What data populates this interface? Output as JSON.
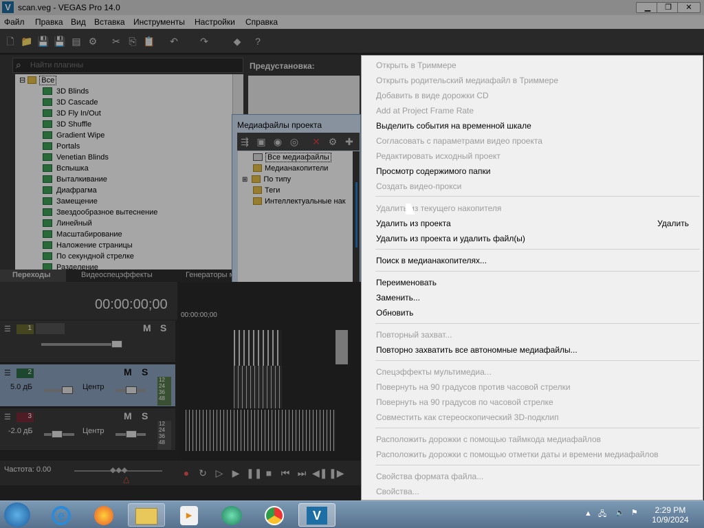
{
  "window": {
    "title": "scan.veg - VEGAS Pro 14.0",
    "minimize": "▁",
    "maximize": "❐",
    "close": "✕"
  },
  "menubar": [
    "Файл",
    "Правка",
    "Вид",
    "Вставка",
    "Инструменты",
    "Настройки",
    "Справка"
  ],
  "plugins": {
    "search_placeholder": "Найти плагины",
    "root": "Все",
    "items": [
      "3D Blinds",
      "3D Cascade",
      "3D Fly In/Out",
      "3D Shuffle",
      "Gradient Wipe",
      "Portals",
      "Venetian Blinds",
      "Вспышка",
      "Выталкивание",
      "Диафрагма",
      "Замещение",
      "Звездообразное вытеснение",
      "Линейный",
      "Масштабирование",
      "Наложение страницы",
      "По секундной стрелке",
      "Разделение"
    ],
    "tabs": [
      "Переходы",
      "Видеоспецэффекты",
      "Генераторы м"
    ]
  },
  "preset": {
    "label": "Предустановка:"
  },
  "media": {
    "title": "Медиафайлы проекта",
    "tree": [
      "Все медиафайлы",
      "Медианакопители",
      "По типу",
      "Теги",
      "Интеллектуальные нак"
    ]
  },
  "timeline": {
    "timecode": "00:00:00;00",
    "ruler_time": "00:00:00;00",
    "tracks": [
      {
        "num": "1",
        "mute": "M",
        "solo": "S"
      },
      {
        "num": "2",
        "mute": "M",
        "solo": "S",
        "volume": "5.0 дБ",
        "pan": "Центр",
        "meter": [
          "12",
          "24",
          "36",
          "48"
        ]
      },
      {
        "num": "3",
        "mute": "M",
        "solo": "S",
        "volume": "-2.0 дБ",
        "pan": "Центр",
        "meter": [
          "12",
          "24",
          "36",
          "48"
        ]
      }
    ],
    "rate": "Частота: 0.00"
  },
  "context_menu": {
    "items": [
      {
        "label": "Открыть в Триммере",
        "disabled": true
      },
      {
        "label": "Открыть родительский медиафайл в Триммере",
        "disabled": true
      },
      {
        "label": "Добавить в виде дорожки CD",
        "disabled": true
      },
      {
        "label": "Add at Project Frame Rate",
        "disabled": true
      },
      {
        "label": "Выделить события на временной шкале",
        "disabled": false
      },
      {
        "label": "Согласовать с параметрами видео проекта",
        "disabled": true
      },
      {
        "label": "Редактировать исходный проект",
        "disabled": true
      },
      {
        "label": "Просмотр содержимого папки",
        "disabled": false
      },
      {
        "label": "Создать видео-прокси",
        "disabled": true
      },
      {
        "label": "Удалить из текущего накопителя",
        "disabled": true
      },
      {
        "label": "Удалить из проекта",
        "disabled": false,
        "shortcut": "Удалить"
      },
      {
        "label": "Удалить из проекта и удалить файл(ы)",
        "disabled": false
      },
      {
        "label": "Поиск в медианакопителях...",
        "disabled": false
      },
      {
        "label": "Переименовать",
        "disabled": false
      },
      {
        "label": "Заменить...",
        "disabled": false
      },
      {
        "label": "Обновить",
        "disabled": false
      },
      {
        "label": "Повторный захват...",
        "disabled": true
      },
      {
        "label": "Повторно захватить все автономные медиафайлы...",
        "disabled": false
      },
      {
        "label": "Спецэффекты мультимедиа...",
        "disabled": true
      },
      {
        "label": "Повернуть на 90 градусов против часовой стрелки",
        "disabled": true
      },
      {
        "label": "Повернуть на 90 градусов по часовой стрелке",
        "disabled": true
      },
      {
        "label": "Совместить как стереоскопический 3D-подклип",
        "disabled": true
      },
      {
        "label": "Расположить дорожки с помощью таймкода медиафайлов",
        "disabled": true
      },
      {
        "label": "Расположить дорожки с помощью отметки даты и времени медиафайлов",
        "disabled": true
      },
      {
        "label": "Свойства формата файла...",
        "disabled": true
      },
      {
        "label": "Свойства...",
        "disabled": true
      }
    ]
  },
  "taskbar": {
    "time": "2:29 PM",
    "date": "10/9/2024"
  }
}
